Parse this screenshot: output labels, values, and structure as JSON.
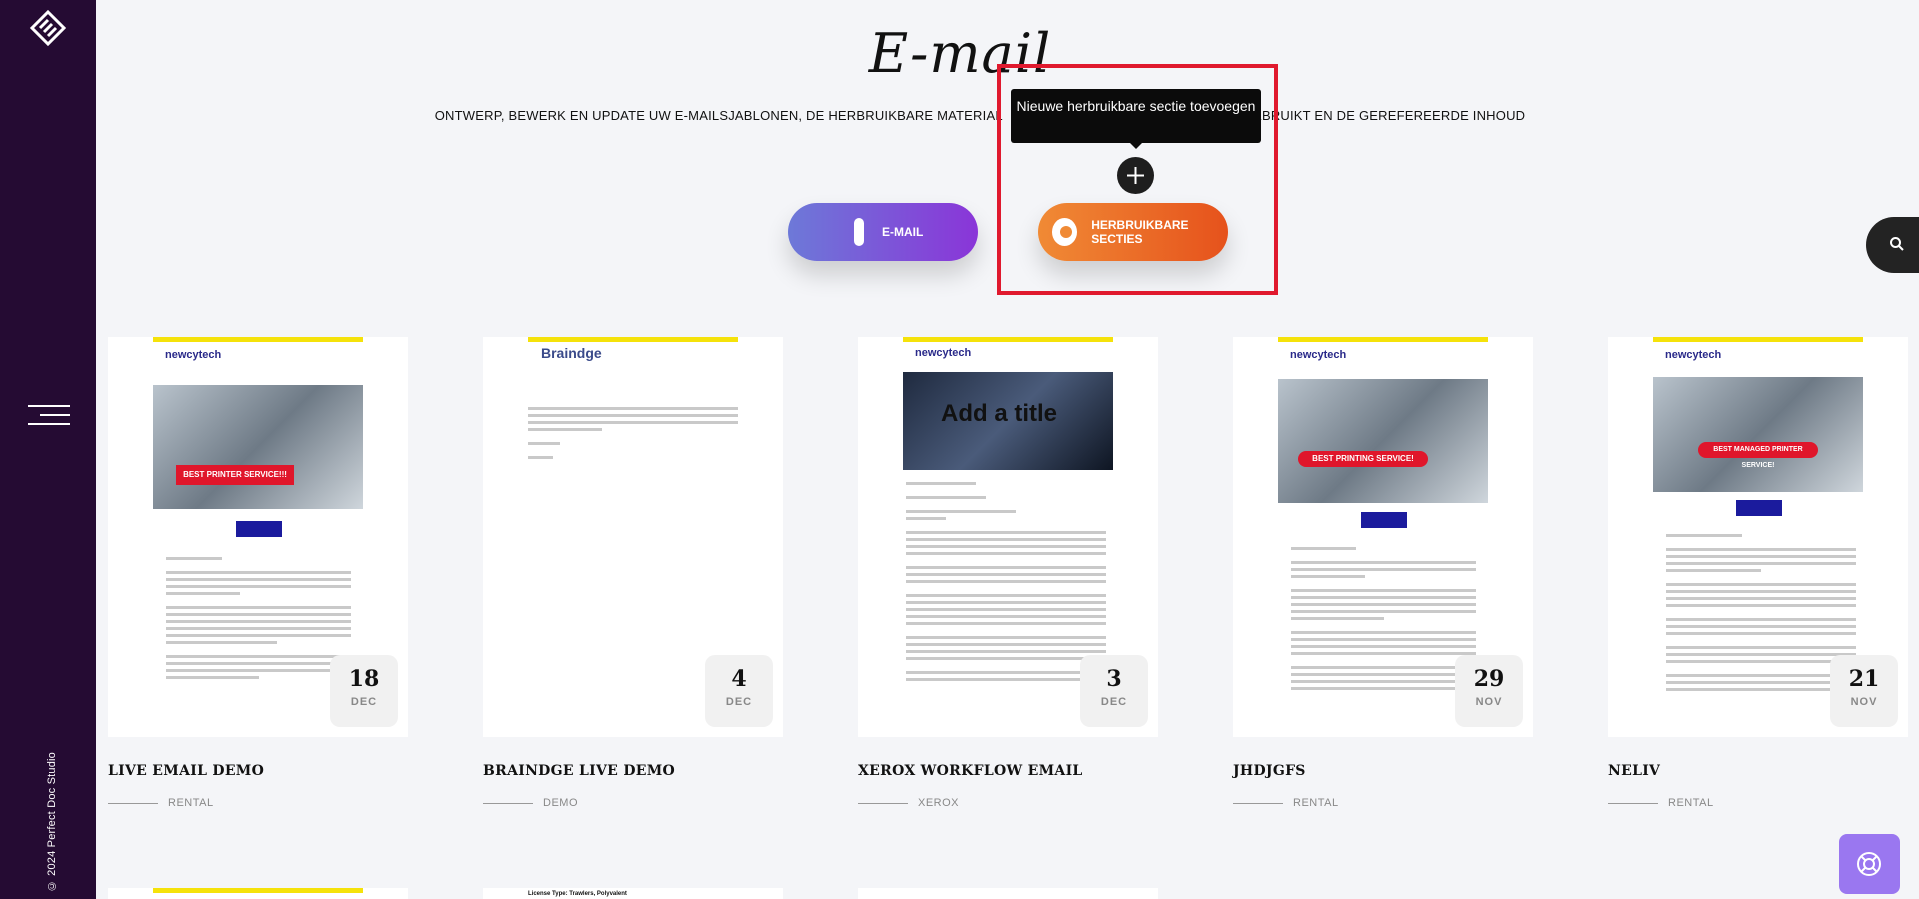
{
  "sidebar": {
    "copyright": "© 2024 Perfect Doc Studio"
  },
  "header": {
    "title": "E-mail",
    "subtitle": "ONTWERP, BEWERK EN UPDATE UW E-MAILSJABLONEN, DE HERBRUIKBARE MATERIAL",
    "subtitle_right": "GEBRUIKT EN DE GEREFEREERDE INHOUD"
  },
  "tooltip": {
    "text": "Nieuwe herbruikbare sectie toevoegen"
  },
  "toggles": {
    "email_label": "E-MAIL",
    "sections_label": "HERBRUIKBARE SECTIES"
  },
  "cards": [
    {
      "title": "LIVE EMAIL DEMO",
      "tag": "RENTAL",
      "day": "18",
      "month": "DEC",
      "brand": "newcytech",
      "banner": "BEST PRINTER SERVICE!!!"
    },
    {
      "title": "BRAINDGE LIVE DEMO",
      "tag": "DEMO",
      "day": "4",
      "month": "DEC",
      "brand": "Braindge"
    },
    {
      "title": "XEROX WORKFLOW EMAIL",
      "tag": "XEROX",
      "day": "3",
      "month": "DEC",
      "brand": "newcytech",
      "photo_text": "Add a title"
    },
    {
      "title": "JHDJGFS",
      "tag": "RENTAL",
      "day": "29",
      "month": "NOV",
      "brand": "newcytech",
      "banner": "BEST PRINTING SERVICE!"
    },
    {
      "title": "NELIV",
      "tag": "RENTAL",
      "day": "21",
      "month": "NOV",
      "brand": "newcytech",
      "banner": "BEST MANAGED PRINTER SERVICE!"
    }
  ],
  "row2": {
    "snippet": "License Type: Trawlers, Polyvalent"
  },
  "colors": {
    "sidebar": "#250b33",
    "email_gradient_start": "#6d79d8",
    "email_gradient_end": "#8a35d8",
    "sections_gradient_start": "#f08a35",
    "sections_gradient_end": "#e6521c",
    "highlight": "#e0192e",
    "support": "#9a77f0"
  },
  "icons": [
    "logo-icon",
    "menu-icon",
    "plus-icon",
    "search-icon",
    "lifebuoy-icon"
  ]
}
